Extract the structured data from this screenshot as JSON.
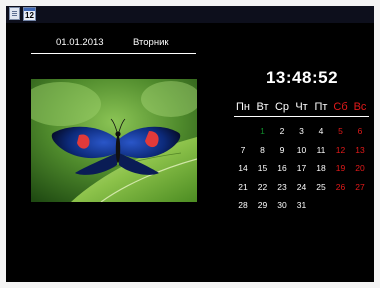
{
  "taskbar": {
    "calendar_icon_day": "12",
    "icons": [
      "document-icon",
      "calendar-icon"
    ]
  },
  "header": {
    "date": "01.01.2013",
    "weekday": "Вторник"
  },
  "clock": {
    "time": "13:48:52"
  },
  "calendar": {
    "weekdays": [
      "Пн",
      "Вт",
      "Ср",
      "Чт",
      "Пт",
      "Сб",
      "Вс"
    ],
    "weekend_color": "#e21a1a",
    "today_color": "#0f8a2a",
    "weeks": [
      [
        "",
        "1",
        "2",
        "3",
        "4",
        "5",
        "6"
      ],
      [
        "7",
        "8",
        "9",
        "10",
        "11",
        "12",
        "13"
      ],
      [
        "14",
        "15",
        "16",
        "17",
        "18",
        "19",
        "20"
      ],
      [
        "21",
        "22",
        "23",
        "24",
        "25",
        "26",
        "27"
      ],
      [
        "28",
        "29",
        "30",
        "31",
        "",
        "",
        ""
      ]
    ]
  },
  "photo": {
    "subject": "butterfly-on-leaf"
  }
}
